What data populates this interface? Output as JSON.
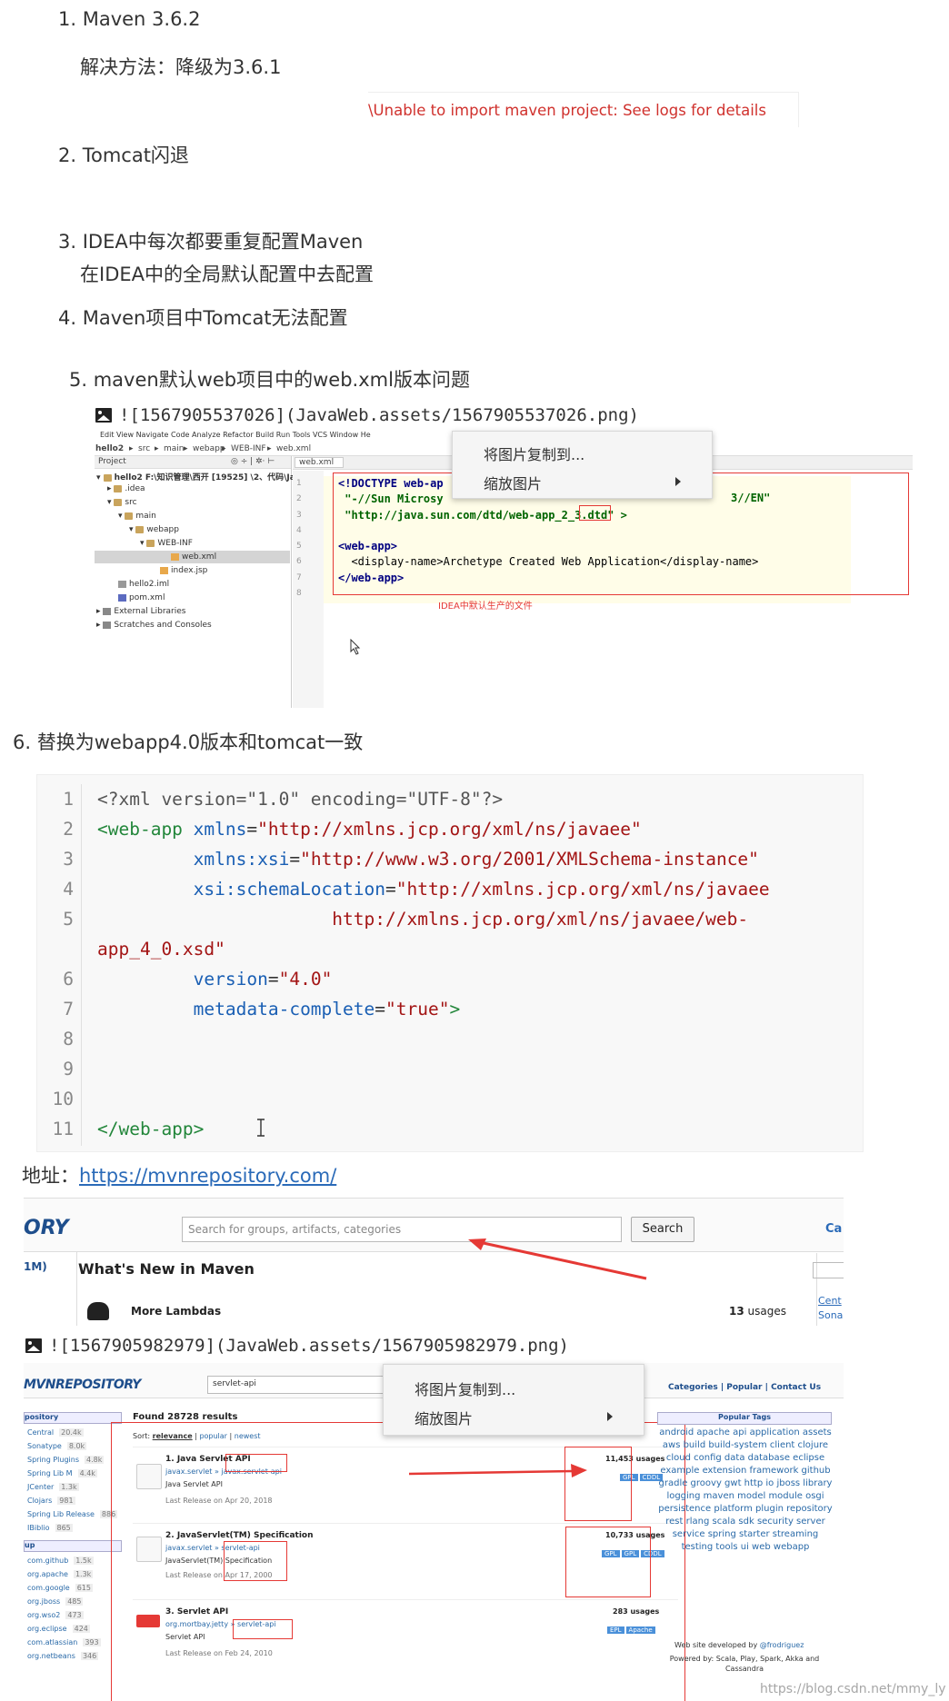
{
  "list": {
    "item1": "1. Maven 3.6.2",
    "item1_sub": "解决方法：降级为3.6.1",
    "item1_error": "\\Unable to import maven project: See logs for details",
    "item2": "2. Tomcat闪退",
    "item3": "3. IDEA中每次都要重复配置Maven",
    "item3_sub": "在IDEA中的全局默认配置中去配置",
    "item4": "4. Maven项目中Tomcat无法配置",
    "item5": "5. maven默认web项目中的web.xml版本问题",
    "item5_img_ref": "![1567905537026](JavaWeb.assets/1567905537026.png)",
    "item6": "6. 替换为webapp4.0版本和tomcat一致"
  },
  "ide": {
    "menu": "Edit  View  Navigate  Code  Analyze  Refactor  Build  Run  Tools  VCS  Window  He",
    "breadcrumb": [
      "hello2",
      "src",
      "main",
      "webapp",
      "WEB-INF",
      "web.xml"
    ],
    "panel_title": "Project",
    "tab_label": "web.xml",
    "tree": [
      {
        "label": "hello2  F:\\知识管理\\西开 [19525] \\2、代码\\Jav",
        "bold": true
      },
      {
        "label": ".idea"
      },
      {
        "label": "src"
      },
      {
        "label": "main"
      },
      {
        "label": "webapp"
      },
      {
        "label": "WEB-INF"
      },
      {
        "label": "web.xml"
      },
      {
        "label": "index.jsp"
      },
      {
        "label": "hello2.iml"
      },
      {
        "label": "pom.xml"
      },
      {
        "label": "External Libraries"
      },
      {
        "label": "Scratches and Consoles"
      }
    ],
    "code": [
      "<!DOCTYPE web-ap",
      " \"-//Sun Microsy",
      " \"http://java.sun.com/dtd/web-app_2_3.dtd\" >",
      "",
      "<web-app>",
      "  <display-name>Archetype Created Web Application</display-name>",
      "</web-app>",
      ""
    ],
    "code_tail_line2": "3//EN\"",
    "annotation": "IDEA中默认生产的文件"
  },
  "ctx_menu": {
    "copy": "将图片复制到...",
    "zoom": "缩放图片"
  },
  "codeblock": {
    "line_numbers": [
      "1",
      "2",
      "3",
      "4",
      "5",
      "",
      "6",
      "7",
      "8",
      "9",
      "10",
      "11"
    ],
    "lines": [
      {
        "plain": "<?xml version=\"1.0\" encoding=\"UTF-8\"?>"
      },
      {
        "tag": "<web-app ",
        "attr": "xmlns",
        "eq": "=",
        "val": "\"http://xmlns.jcp.org/xml/ns/javaee\""
      },
      {
        "indent": "         ",
        "attr": "xmlns:xsi",
        "eq": "=",
        "val": "\"http://www.w3.org/2001/XMLSchema-instance\""
      },
      {
        "indent": "         ",
        "attr": "xsi:schemaLocation",
        "eq": "=",
        "val": "\"http://xmlns.jcp.org/xml/ns/javaee"
      },
      {
        "indent": "                      ",
        "val": "http://xmlns.jcp.org/xml/ns/javaee/web-"
      },
      {
        "val": "app_4_0.xsd\""
      },
      {
        "indent": "         ",
        "attr": "version",
        "eq": "=",
        "val": "\"4.0\""
      },
      {
        "indent": "         ",
        "attr": "metadata-complete",
        "eq": "=",
        "val": "\"true\"",
        "tail": ">"
      },
      {},
      {},
      {},
      {
        "tag": "</web-app>"
      }
    ]
  },
  "address": {
    "label": "地址：",
    "url": "https://mvnrepository.com/"
  },
  "mvn1": {
    "logo": "ORY",
    "search_placeholder": "Search for groups, artifacts, categories",
    "search_button": "Search",
    "right_cut": "Ca",
    "left_badge": "1M)",
    "heading": "What's New in Maven",
    "item": "More Lambdas",
    "usages_num": "13",
    "usages_word": "usages",
    "right_link": "Cent",
    "right_link2": "Sona"
  },
  "item7_img_ref": "![1567905982979](JavaWeb.assets/1567905982979.png)",
  "mvn2": {
    "logo": "MVNREPOSITORY",
    "search_value": "servlet-api",
    "nav": [
      "Categories",
      "Popular",
      "Contact Us"
    ],
    "found": "Found 28728 results",
    "sort_label": "Sort:",
    "sort_options": [
      "relevance",
      "popular",
      "newest"
    ],
    "side_heading": "pository",
    "side_items": [
      {
        "name": "Central",
        "count": "20.4k"
      },
      {
        "name": "Sonatype",
        "count": "8.0k"
      },
      {
        "name": "Spring Plugins",
        "count": "4.8k"
      },
      {
        "name": "Spring Lib M",
        "count": "4.4k"
      },
      {
        "name": "JCenter",
        "count": "1.3k"
      },
      {
        "name": "Clojars",
        "count": "981"
      },
      {
        "name": "Spring Lib Release",
        "count": "886"
      },
      {
        "name": "IBiblio",
        "count": "865"
      }
    ],
    "side_heading2": "up",
    "side_items2": [
      {
        "name": "com.github",
        "count": "1.5k"
      },
      {
        "name": "org.apache",
        "count": "1.3k"
      },
      {
        "name": "com.google",
        "count": "615"
      },
      {
        "name": "org.jboss",
        "count": "485"
      },
      {
        "name": "org.wso2",
        "count": "473"
      },
      {
        "name": "org.eclipse",
        "count": "424"
      },
      {
        "name": "com.atlassian",
        "count": "393"
      },
      {
        "name": "org.netbeans",
        "count": "346"
      }
    ],
    "results": [
      {
        "title": "1. Java Servlet API",
        "group": "javax.servlet",
        "artifact": "javax.servlet-api",
        "desc": "Java Servlet API",
        "release": "Last Release on Apr 20, 2018",
        "usages": "11,453 usages",
        "tags": [
          "GPL",
          "CDDL"
        ]
      },
      {
        "title": "2. JavaServlet(TM) Specification",
        "group": "javax.servlet",
        "artifact": "servlet-api",
        "desc": "JavaServlet(TM) Specification",
        "release": "Last Release on Apr 17, 2000",
        "usages": "10,733 usages",
        "tags": [
          "GPL",
          "GPL",
          "CDDL"
        ]
      },
      {
        "title": "3. Servlet API",
        "group": "org.mortbay.jetty",
        "artifact": "servlet-api",
        "desc": "Servlet API",
        "release": "Last Release on Feb 24, 2010",
        "usages": "283 usages",
        "tags": [
          "EPL",
          "Apache"
        ]
      }
    ],
    "popular_tags_heading": "Popular Tags",
    "tags_cloud": "android apache api application assets aws build build-system client clojure cloud config data database eclipse example extension framework github gradle groovy gwt http io jboss library logging maven model module osgi persistence platform plugin repository rest rlang scala sdk security server service spring starter streaming testing tools ui web webapp",
    "dev_by": "Web site developed by",
    "dev_name": "@frodriguez",
    "powered": "Powered by: Scala, Play, Spark, Akka and Cassandra"
  },
  "watermark": "https://blog.csdn.net/mmy_ly"
}
